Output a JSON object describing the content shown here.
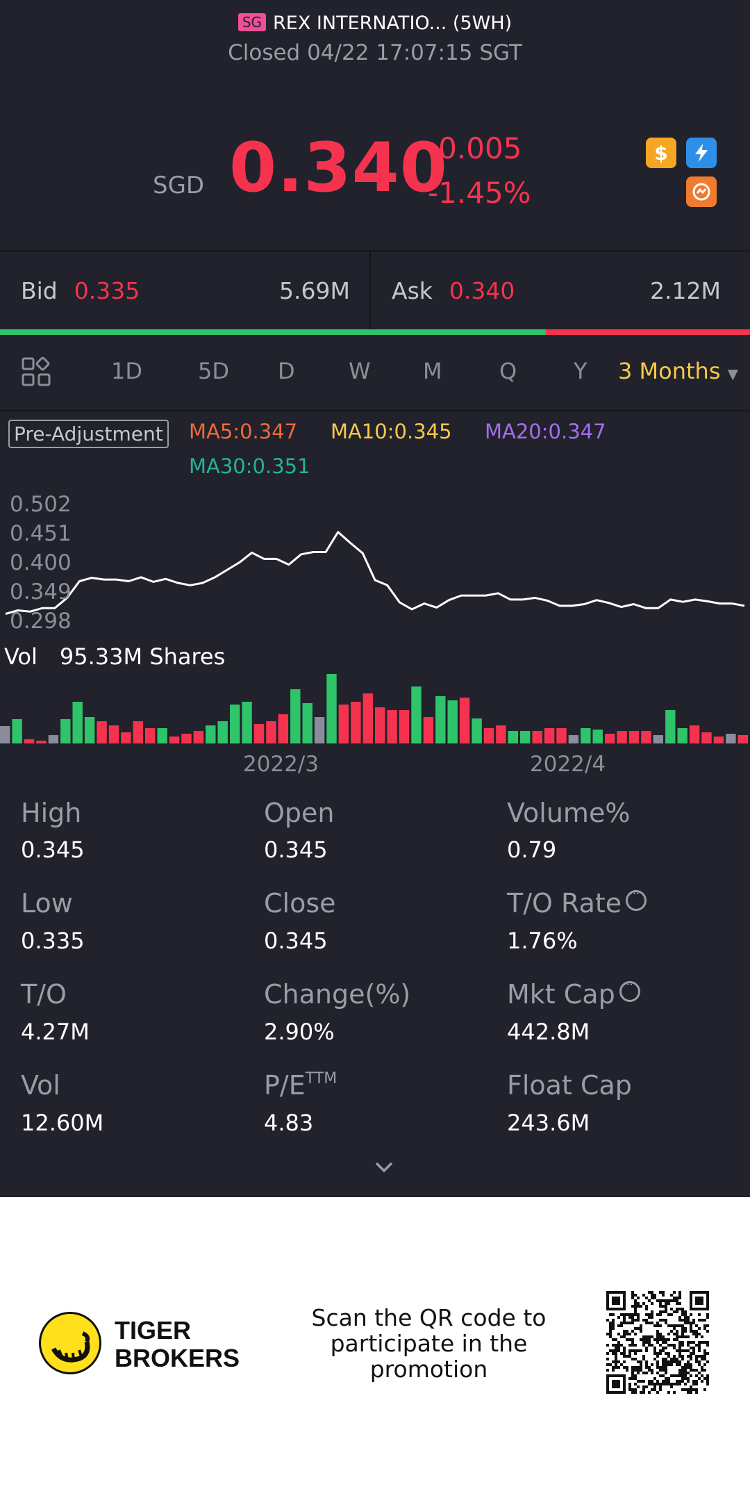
{
  "header": {
    "market_badge": "SG",
    "title": "REX INTERNATIO... (5WH)",
    "status": "Closed 04/22 17:07:15 SGT"
  },
  "quote": {
    "currency": "SGD",
    "price": "0.340",
    "change": "-0.005",
    "change_pct": "-1.45%",
    "icons": [
      "dollar-icon",
      "flash-icon",
      "swap-icon"
    ],
    "colors": {
      "down": "#f5334f",
      "up": "#2fc46a",
      "accent": "#f7c948"
    }
  },
  "bid_ask": {
    "bid_label": "Bid",
    "bid_price": "0.335",
    "bid_size": "5.69M",
    "ask_label": "Ask",
    "ask_price": "0.340",
    "ask_size": "2.12M",
    "bid_ratio": 0.728
  },
  "periods": {
    "tabs": [
      "1D",
      "5D",
      "D",
      "W",
      "M",
      "Q",
      "Y"
    ],
    "selected": "3 Months"
  },
  "indicators": {
    "adjust": "Pre-Adjustment",
    "ma5": "MA5:0.347",
    "ma10": "MA10:0.345",
    "ma20": "MA20:0.347",
    "ma30": "MA30:0.351"
  },
  "chart_data": {
    "type": "line",
    "y_ticks": [
      "0.502",
      "0.451",
      "0.400",
      "0.349",
      "0.298"
    ],
    "ylim": [
      0.298,
      0.502
    ],
    "x_ticks": [
      "2022/3",
      "2022/4"
    ],
    "price": [
      0.312,
      0.318,
      0.316,
      0.322,
      0.322,
      0.34,
      0.369,
      0.375,
      0.372,
      0.372,
      0.369,
      0.376,
      0.368,
      0.373,
      0.366,
      0.362,
      0.366,
      0.376,
      0.389,
      0.402,
      0.419,
      0.408,
      0.408,
      0.398,
      0.416,
      0.42,
      0.42,
      0.455,
      0.436,
      0.418,
      0.371,
      0.362,
      0.332,
      0.32,
      0.33,
      0.323,
      0.336,
      0.344,
      0.344,
      0.344,
      0.348,
      0.337,
      0.337,
      0.34,
      0.335,
      0.326,
      0.326,
      0.329,
      0.336,
      0.331,
      0.324,
      0.329,
      0.322,
      0.322,
      0.337,
      0.333,
      0.337,
      0.334,
      0.33,
      0.33,
      0.326
    ],
    "volume_label": "Vol",
    "volume_total": "95.33M Shares",
    "volume": [
      {
        "v": 0.25,
        "c": "g"
      },
      {
        "v": 0.35,
        "c": "u"
      },
      {
        "v": 0.06,
        "c": "d"
      },
      {
        "v": 0.04,
        "c": "d"
      },
      {
        "v": 0.12,
        "c": "g"
      },
      {
        "v": 0.35,
        "c": "u"
      },
      {
        "v": 0.6,
        "c": "u"
      },
      {
        "v": 0.38,
        "c": "u"
      },
      {
        "v": 0.32,
        "c": "d"
      },
      {
        "v": 0.26,
        "c": "d"
      },
      {
        "v": 0.16,
        "c": "d"
      },
      {
        "v": 0.32,
        "c": "d"
      },
      {
        "v": 0.22,
        "c": "d"
      },
      {
        "v": 0.22,
        "c": "u"
      },
      {
        "v": 0.1,
        "c": "d"
      },
      {
        "v": 0.14,
        "c": "d"
      },
      {
        "v": 0.18,
        "c": "d"
      },
      {
        "v": 0.26,
        "c": "u"
      },
      {
        "v": 0.32,
        "c": "u"
      },
      {
        "v": 0.56,
        "c": "u"
      },
      {
        "v": 0.6,
        "c": "u"
      },
      {
        "v": 0.28,
        "c": "d"
      },
      {
        "v": 0.32,
        "c": "d"
      },
      {
        "v": 0.42,
        "c": "d"
      },
      {
        "v": 0.78,
        "c": "u"
      },
      {
        "v": 0.58,
        "c": "u"
      },
      {
        "v": 0.38,
        "c": "g"
      },
      {
        "v": 1.0,
        "c": "u"
      },
      {
        "v": 0.56,
        "c": "d"
      },
      {
        "v": 0.6,
        "c": "d"
      },
      {
        "v": 0.72,
        "c": "d"
      },
      {
        "v": 0.52,
        "c": "d"
      },
      {
        "v": 0.48,
        "c": "d"
      },
      {
        "v": 0.48,
        "c": "d"
      },
      {
        "v": 0.82,
        "c": "u"
      },
      {
        "v": 0.38,
        "c": "d"
      },
      {
        "v": 0.68,
        "c": "u"
      },
      {
        "v": 0.62,
        "c": "u"
      },
      {
        "v": 0.66,
        "c": "d"
      },
      {
        "v": 0.36,
        "c": "u"
      },
      {
        "v": 0.22,
        "c": "d"
      },
      {
        "v": 0.26,
        "c": "d"
      },
      {
        "v": 0.18,
        "c": "u"
      },
      {
        "v": 0.18,
        "c": "u"
      },
      {
        "v": 0.18,
        "c": "d"
      },
      {
        "v": 0.22,
        "c": "d"
      },
      {
        "v": 0.22,
        "c": "d"
      },
      {
        "v": 0.12,
        "c": "g"
      },
      {
        "v": 0.22,
        "c": "u"
      },
      {
        "v": 0.2,
        "c": "u"
      },
      {
        "v": 0.14,
        "c": "d"
      },
      {
        "v": 0.18,
        "c": "d"
      },
      {
        "v": 0.18,
        "c": "d"
      },
      {
        "v": 0.18,
        "c": "d"
      },
      {
        "v": 0.12,
        "c": "g"
      },
      {
        "v": 0.48,
        "c": "u"
      },
      {
        "v": 0.22,
        "c": "u"
      },
      {
        "v": 0.26,
        "c": "d"
      },
      {
        "v": 0.16,
        "c": "d"
      },
      {
        "v": 0.1,
        "c": "d"
      },
      {
        "v": 0.14,
        "c": "g"
      },
      {
        "v": 0.12,
        "c": "d"
      }
    ]
  },
  "stats": [
    {
      "label": "High",
      "value": "0.345"
    },
    {
      "label": "Open",
      "value": "0.345"
    },
    {
      "label": "Volume%",
      "value": "0.79"
    },
    {
      "label": "Low",
      "value": "0.335"
    },
    {
      "label": "Close",
      "value": "0.345"
    },
    {
      "label": "T/O Rate",
      "value": "1.76%"
    },
    {
      "label": "T/O",
      "value": "4.27M"
    },
    {
      "label": "Change(%)",
      "value": "2.90%"
    },
    {
      "label": "Mkt Cap",
      "value": "442.8M"
    },
    {
      "label": "Vol",
      "value": "12.60M"
    },
    {
      "label": "P/E",
      "sup": "TTM",
      "value": "4.83"
    },
    {
      "label": "Float Cap",
      "value": "243.6M"
    }
  ],
  "footer": {
    "brand_line1": "TIGER",
    "brand_line2": "BROKERS",
    "promo_line1": "Scan the QR code to",
    "promo_line2": "participate in the",
    "promo_line3": "promotion"
  }
}
